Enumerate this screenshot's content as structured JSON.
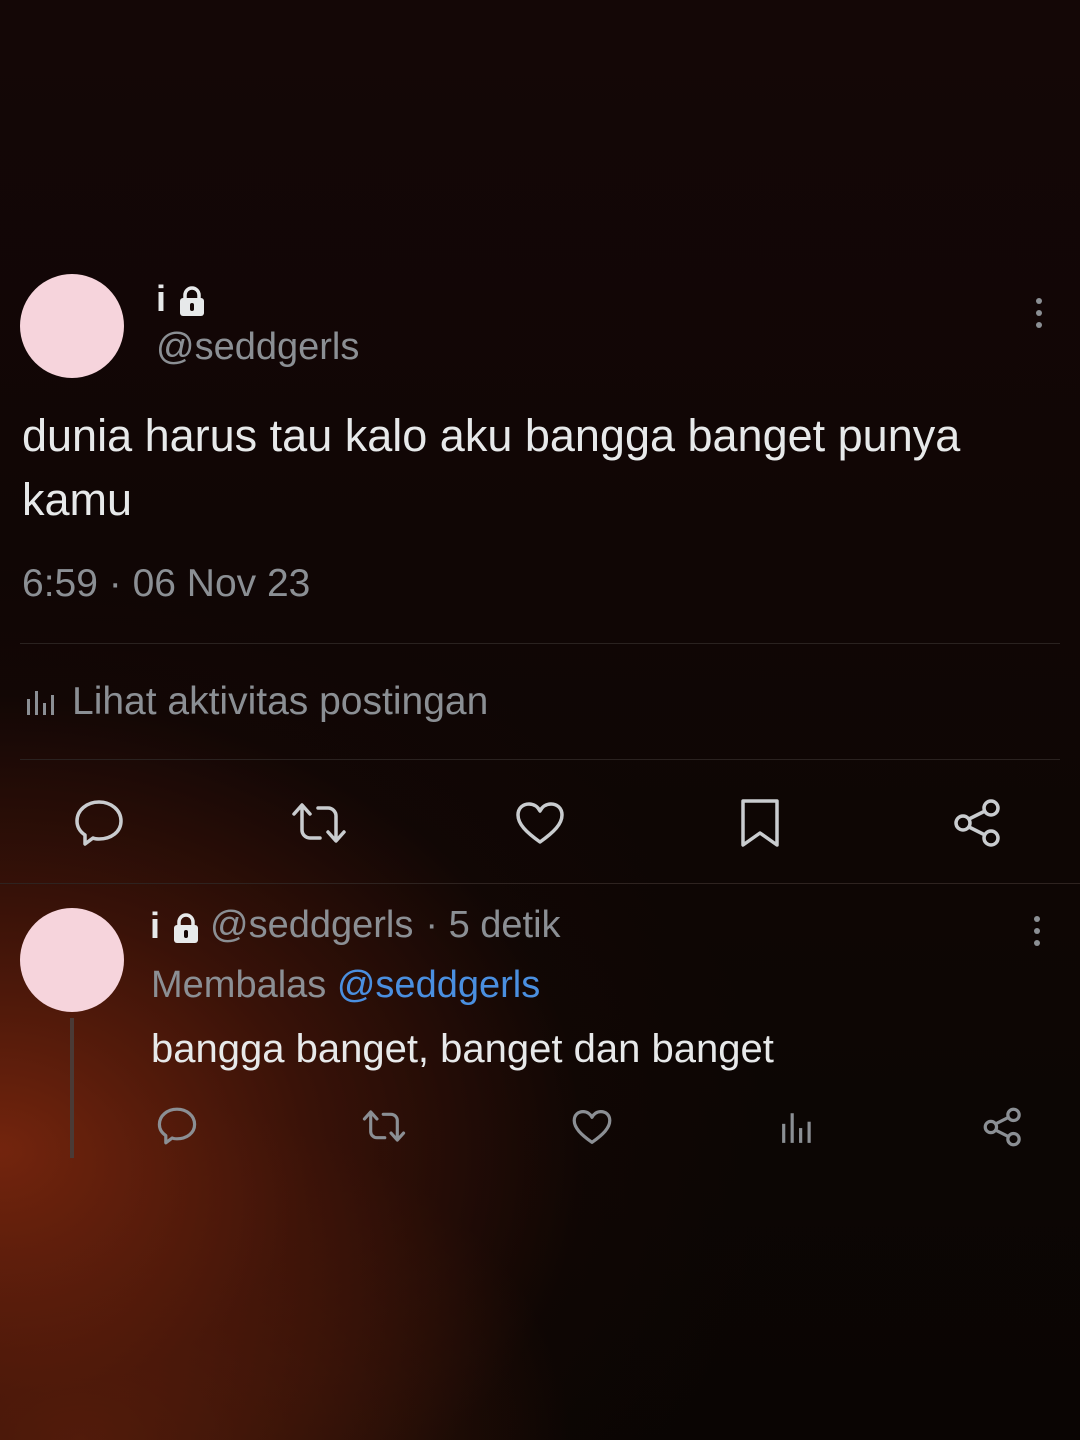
{
  "tweet": {
    "display_name": "i",
    "handle": "@seddgerls",
    "text": "dunia harus tau kalo aku bangga banget punya kamu",
    "timestamp": "6:59 · 06 Nov 23",
    "activity_label": "Lihat aktivitas postingan",
    "icons": [
      "lock-icon",
      "more-icon",
      "analytics-icon",
      "reply-icon",
      "repost-icon",
      "like-icon",
      "bookmark-icon",
      "share-icon"
    ]
  },
  "reply": {
    "display_name": "i",
    "handle": "@seddgerls",
    "time": "· 5 detik",
    "replying_prefix": "Membalas",
    "replying_to": "@seddgerls",
    "text": "bangga banget, banget dan banget",
    "icons": [
      "reply-icon",
      "repost-icon",
      "like-icon",
      "views-icon",
      "share-icon"
    ]
  },
  "colors": {
    "avatar": "#f6d4dc",
    "text": "#e7e9ea",
    "muted": "#8b8f94",
    "link": "#4a8fe0"
  }
}
